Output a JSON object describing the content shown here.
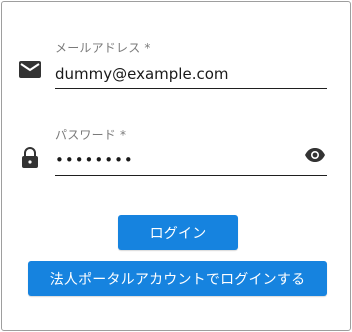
{
  "email": {
    "label": "メールアドレス *",
    "value": "dummy@example.com",
    "icon": "mail-icon"
  },
  "password": {
    "label": "パスワード *",
    "value": "••••••••",
    "icon": "lock-icon",
    "toggle_icon": "eye-icon"
  },
  "buttons": {
    "login": "ログイン",
    "corporate_login": "法人ポータルアカウントでログインする"
  },
  "colors": {
    "primary": "#1683df",
    "text": "#1a1a1a",
    "label": "#7a7a7a",
    "icon": "#333333"
  }
}
